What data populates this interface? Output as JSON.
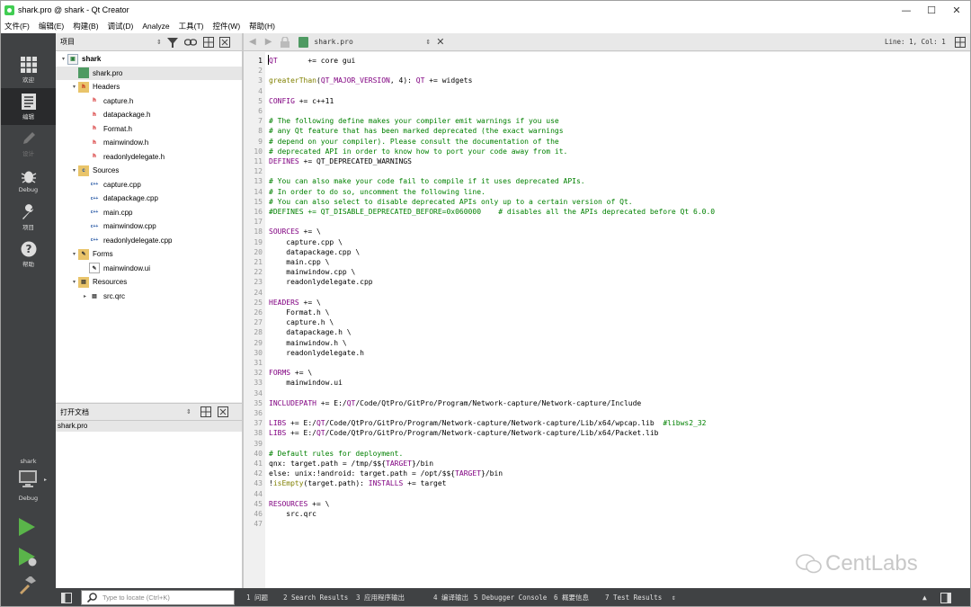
{
  "window": {
    "title": "shark.pro @ shark - Qt Creator",
    "minimize": "—",
    "maximize": "☐",
    "close": "✕"
  },
  "menu": [
    "文件(F)",
    "编辑(E)",
    "构建(B)",
    "调试(D)",
    "Analyze",
    "工具(T)",
    "控件(W)",
    "帮助(H)"
  ],
  "modes": [
    {
      "label": "欢迎",
      "icon": "grid-icon"
    },
    {
      "label": "编辑",
      "icon": "edit-doc-icon"
    },
    {
      "label": "设计",
      "icon": "pencil-icon"
    },
    {
      "label": "Debug",
      "icon": "bug-icon"
    },
    {
      "label": "项目",
      "icon": "wrench-icon"
    },
    {
      "label": "帮助",
      "icon": "help-icon"
    }
  ],
  "kit": {
    "project": "shark",
    "config": "Debug"
  },
  "project_pane": {
    "title": "项目"
  },
  "tree": [
    {
      "label": "shark",
      "level": 0,
      "type": "project",
      "expanded": true,
      "bold": true
    },
    {
      "label": "shark.pro",
      "level": 1,
      "type": "pro",
      "selected": true
    },
    {
      "label": "Headers",
      "level": 1,
      "type": "folder-h",
      "expanded": true
    },
    {
      "label": "capture.h",
      "level": 2,
      "type": "h"
    },
    {
      "label": "datapackage.h",
      "level": 2,
      "type": "h"
    },
    {
      "label": "Format.h",
      "level": 2,
      "type": "h"
    },
    {
      "label": "mainwindow.h",
      "level": 2,
      "type": "h"
    },
    {
      "label": "readonlydelegate.h",
      "level": 2,
      "type": "h"
    },
    {
      "label": "Sources",
      "level": 1,
      "type": "folder-cpp",
      "expanded": true
    },
    {
      "label": "capture.cpp",
      "level": 2,
      "type": "cpp"
    },
    {
      "label": "datapackage.cpp",
      "level": 2,
      "type": "cpp"
    },
    {
      "label": "main.cpp",
      "level": 2,
      "type": "cpp"
    },
    {
      "label": "mainwindow.cpp",
      "level": 2,
      "type": "cpp"
    },
    {
      "label": "readonlydelegate.cpp",
      "level": 2,
      "type": "cpp"
    },
    {
      "label": "Forms",
      "level": 1,
      "type": "folder-ui",
      "expanded": true
    },
    {
      "label": "mainwindow.ui",
      "level": 2,
      "type": "ui"
    },
    {
      "label": "Resources",
      "level": 1,
      "type": "folder-qrc",
      "expanded": true
    },
    {
      "label": "src.qrc",
      "level": 2,
      "type": "qrc",
      "expandable": true
    }
  ],
  "open_docs": {
    "title": "打开文档",
    "items": [
      "shark.pro"
    ]
  },
  "editor": {
    "file": "shark.pro",
    "position": "Line: 1, Col: 1"
  },
  "code": [
    "QT       += core gui",
    "",
    "greaterThan(QT_MAJOR_VERSION, 4): QT += widgets",
    "",
    "CONFIG += c++11",
    "",
    "# The following define makes your compiler emit warnings if you use",
    "# any Qt feature that has been marked deprecated (the exact warnings",
    "# depend on your compiler). Please consult the documentation of the",
    "# deprecated API in order to know how to port your code away from it.",
    "DEFINES += QT_DEPRECATED_WARNINGS",
    "",
    "# You can also make your code fail to compile if it uses deprecated APIs.",
    "# In order to do so, uncomment the following line.",
    "# You can also select to disable deprecated APIs only up to a certain version of Qt.",
    "#DEFINES += QT_DISABLE_DEPRECATED_BEFORE=0x060000    # disables all the APIs deprecated before Qt 6.0.0",
    "",
    "SOURCES += \\",
    "    capture.cpp \\",
    "    datapackage.cpp \\",
    "    main.cpp \\",
    "    mainwindow.cpp \\",
    "    readonlydelegate.cpp",
    "",
    "HEADERS += \\",
    "    Format.h \\",
    "    capture.h \\",
    "    datapackage.h \\",
    "    mainwindow.h \\",
    "    readonlydelegate.h",
    "",
    "FORMS += \\",
    "    mainwindow.ui",
    "",
    "INCLUDEPATH += E:/QT/Code/QtPro/GitPro/Program/Network-capture/Network-capture/Include",
    "",
    "LIBS += E:/QT/Code/QtPro/GitPro/Program/Network-capture/Network-capture/Lib/x64/wpcap.lib  #libws2_32",
    "LIBS += E:/QT/Code/QtPro/GitPro/Program/Network-capture/Network-capture/Lib/x64/Packet.lib",
    "",
    "# Default rules for deployment.",
    "qnx: target.path = /tmp/$${TARGET}/bin",
    "else: unix:!android: target.path = /opt/$${TARGET}/bin",
    "!isEmpty(target.path): INSTALLS += target",
    "",
    "RESOURCES += \\",
    "    src.qrc",
    ""
  ],
  "locate_placeholder": "Type to locate (Ctrl+K)",
  "output_tabs": [
    "1  问题",
    "2  Search Results",
    "3  应用程序输出",
    "4  编译输出",
    "5  Debugger Console",
    "6  概要信息",
    "7  Test Results"
  ],
  "watermark": "CentLabs",
  "colors": {
    "modebar": "#404244",
    "keyword": "#800080",
    "comment": "#008000",
    "function": "#808000"
  }
}
